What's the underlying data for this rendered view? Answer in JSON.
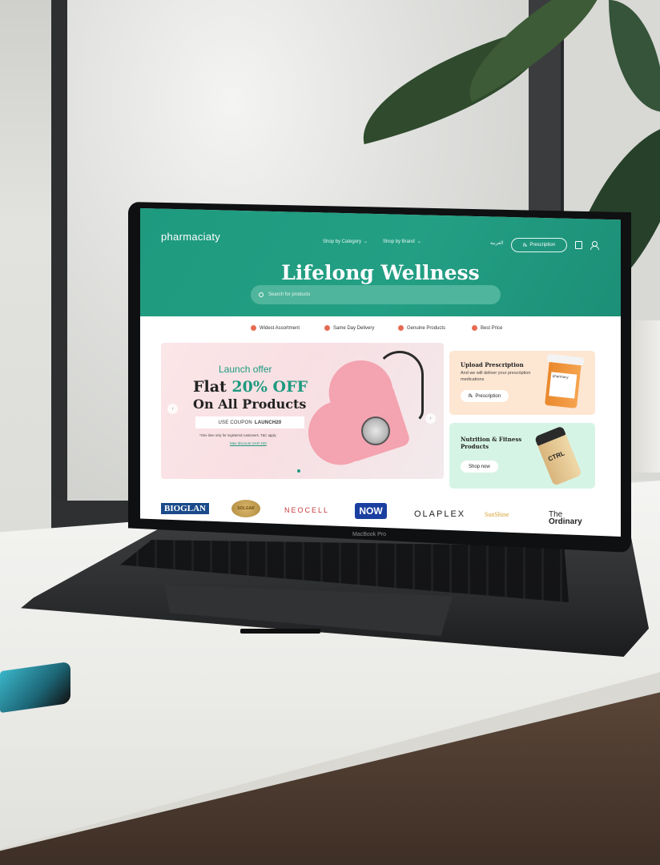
{
  "site": {
    "logo": "pharmaciaty",
    "nav": [
      {
        "label": "Shop by Category"
      },
      {
        "label": "Shop by Brand"
      }
    ],
    "language": "العربية",
    "prescription_label": "Prescription",
    "hero_title": "Lifelong Wellness",
    "search_placeholder": "Search for products"
  },
  "perks": [
    {
      "label": "Widest Assortment"
    },
    {
      "label": "Same Day Delivery"
    },
    {
      "label": "Genuine Products"
    },
    {
      "label": "Best Price"
    }
  ],
  "offer": {
    "launch": "Launch offer",
    "flat_prefix": "Flat ",
    "percent": "20% OFF",
    "subtitle": "On All Products",
    "coupon_prefix": "USE COUPON",
    "coupon_code": "LAUNCH20",
    "terms": "*One time only for registered customers. T&C apply",
    "max_discount": "Max discount SAR 100"
  },
  "cards": {
    "upload": {
      "title": "Upload Prescription",
      "subtitle": "And we will deliver your prescription medications",
      "button": "Prescription",
      "bottle_label": "pharmacy"
    },
    "nutrition": {
      "title": "Nutrition & Fitness Products",
      "button": "Shop now",
      "shaker_label": "CTRL"
    }
  },
  "brands": {
    "bioglan": "BIOGLAN",
    "solgar": "SOLGAR",
    "neocell": "NEOCELL",
    "now": "NOW",
    "olaplex": "OLAPLEX",
    "sunshine": "SunShine",
    "ordinary_1": "The",
    "ordinary_2": "Ordinary"
  },
  "laptop": {
    "model": "MacBook Pro"
  }
}
